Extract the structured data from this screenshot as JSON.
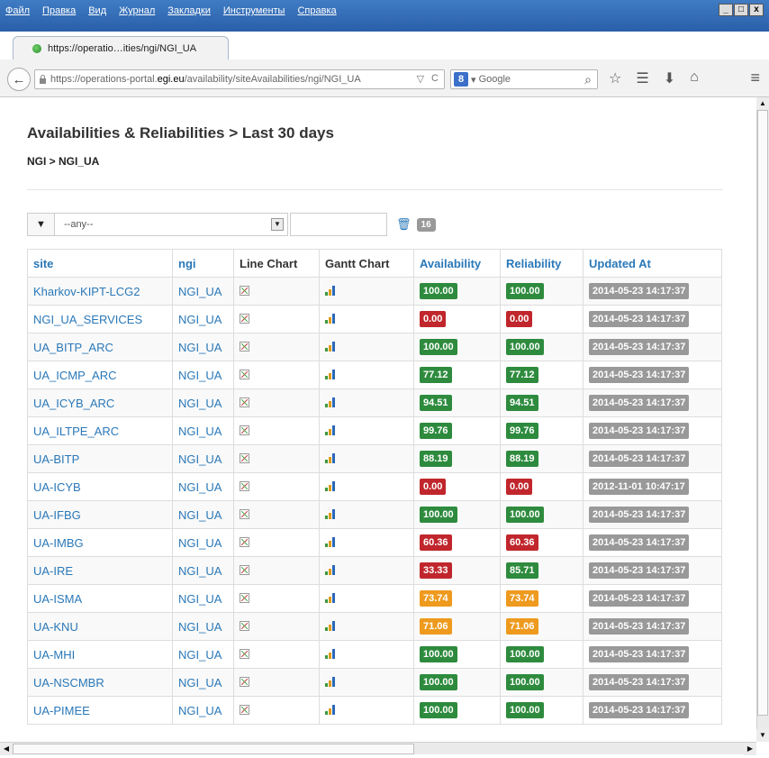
{
  "menu": [
    "Файл",
    "Правка",
    "Вид",
    "Журнал",
    "Закладки",
    "Инструменты",
    "Справка"
  ],
  "window_buttons": [
    "_",
    "□",
    "x"
  ],
  "tab": {
    "title": "https://operatio…ities/ngi/NGI_UA",
    "new_tab": "+"
  },
  "address": {
    "prefix": "https://operations-portal.",
    "host": "egi.eu",
    "path": "/availability/siteAvailabilities/ngi/NGI_UA",
    "reload": "C"
  },
  "search": {
    "engine_badge": "8",
    "placeholder": "Google"
  },
  "page": {
    "title": "Availabilities & Reliabilities > Last 30 days",
    "breadcrumb": "NGI > NGI_UA"
  },
  "filter": {
    "selected": "--any--",
    "count": "16"
  },
  "table": {
    "headers": [
      "site",
      "ngi",
      "Line Chart",
      "Gantt Chart",
      "Availability",
      "Reliability",
      "Updated At"
    ],
    "rows": [
      {
        "site": "Kharkov-KIPT-LCG2",
        "ngi": "NGI_UA",
        "availability": "100.00",
        "availability_color": "#2e8b3e",
        "reliability": "100.00",
        "reliability_color": "#2e8b3e",
        "updated": "2014-05-23 14:17:37"
      },
      {
        "site": "NGI_UA_SERVICES",
        "ngi": "NGI_UA",
        "availability": "0.00",
        "availability_color": "#c0262c",
        "reliability": "0.00",
        "reliability_color": "#c0262c",
        "updated": "2014-05-23 14:17:37"
      },
      {
        "site": "UA_BITP_ARC",
        "ngi": "NGI_UA",
        "availability": "100.00",
        "availability_color": "#2e8b3e",
        "reliability": "100.00",
        "reliability_color": "#2e8b3e",
        "updated": "2014-05-23 14:17:37"
      },
      {
        "site": "UA_ICMP_ARC",
        "ngi": "NGI_UA",
        "availability": "77.12",
        "availability_color": "#2e8b3e",
        "reliability": "77.12",
        "reliability_color": "#2e8b3e",
        "updated": "2014-05-23 14:17:37"
      },
      {
        "site": "UA_ICYB_ARC",
        "ngi": "NGI_UA",
        "availability": "94.51",
        "availability_color": "#2e8b3e",
        "reliability": "94.51",
        "reliability_color": "#2e8b3e",
        "updated": "2014-05-23 14:17:37"
      },
      {
        "site": "UA_ILTPE_ARC",
        "ngi": "NGI_UA",
        "availability": "99.76",
        "availability_color": "#2e8b3e",
        "reliability": "99.76",
        "reliability_color": "#2e8b3e",
        "updated": "2014-05-23 14:17:37"
      },
      {
        "site": "UA-BITP",
        "ngi": "NGI_UA",
        "availability": "88.19",
        "availability_color": "#2e8b3e",
        "reliability": "88.19",
        "reliability_color": "#2e8b3e",
        "updated": "2014-05-23 14:17:37"
      },
      {
        "site": "UA-ICYB",
        "ngi": "NGI_UA",
        "availability": "0.00",
        "availability_color": "#c0262c",
        "reliability": "0.00",
        "reliability_color": "#c0262c",
        "updated": "2012-11-01 10:47:17"
      },
      {
        "site": "UA-IFBG",
        "ngi": "NGI_UA",
        "availability": "100.00",
        "availability_color": "#2e8b3e",
        "reliability": "100.00",
        "reliability_color": "#2e8b3e",
        "updated": "2014-05-23 14:17:37"
      },
      {
        "site": "UA-IMBG",
        "ngi": "NGI_UA",
        "availability": "60.36",
        "availability_color": "#c0262c",
        "reliability": "60.36",
        "reliability_color": "#c0262c",
        "updated": "2014-05-23 14:17:37"
      },
      {
        "site": "UA-IRE",
        "ngi": "NGI_UA",
        "availability": "33.33",
        "availability_color": "#c0262c",
        "reliability": "85.71",
        "reliability_color": "#2e8b3e",
        "updated": "2014-05-23 14:17:37"
      },
      {
        "site": "UA-ISMA",
        "ngi": "NGI_UA",
        "availability": "73.74",
        "availability_color": "#ee9a1e",
        "reliability": "73.74",
        "reliability_color": "#ee9a1e",
        "updated": "2014-05-23 14:17:37"
      },
      {
        "site": "UA-KNU",
        "ngi": "NGI_UA",
        "availability": "71.06",
        "availability_color": "#ee9a1e",
        "reliability": "71.06",
        "reliability_color": "#ee9a1e",
        "updated": "2014-05-23 14:17:37"
      },
      {
        "site": "UA-MHI",
        "ngi": "NGI_UA",
        "availability": "100.00",
        "availability_color": "#2e8b3e",
        "reliability": "100.00",
        "reliability_color": "#2e8b3e",
        "updated": "2014-05-23 14:17:37"
      },
      {
        "site": "UA-NSCMBR",
        "ngi": "NGI_UA",
        "availability": "100.00",
        "availability_color": "#2e8b3e",
        "reliability": "100.00",
        "reliability_color": "#2e8b3e",
        "updated": "2014-05-23 14:17:37"
      },
      {
        "site": "UA-PIMEE",
        "ngi": "NGI_UA",
        "availability": "100.00",
        "availability_color": "#2e8b3e",
        "reliability": "100.00",
        "reliability_color": "#2e8b3e",
        "updated": "2014-05-23 14:17:37"
      }
    ]
  },
  "icons": {
    "back": "back-arrow-icon",
    "lock": "lock-icon",
    "search": "search-icon",
    "star": "star-icon",
    "reading_list": "reading-list-icon",
    "download": "download-icon",
    "home": "home-icon",
    "menu": "hamburger-menu-icon",
    "filter": "filter-icon",
    "trash": "trash-icon",
    "line_chart": "line-chart-icon",
    "gantt_chart": "gantt-chart-icon"
  }
}
